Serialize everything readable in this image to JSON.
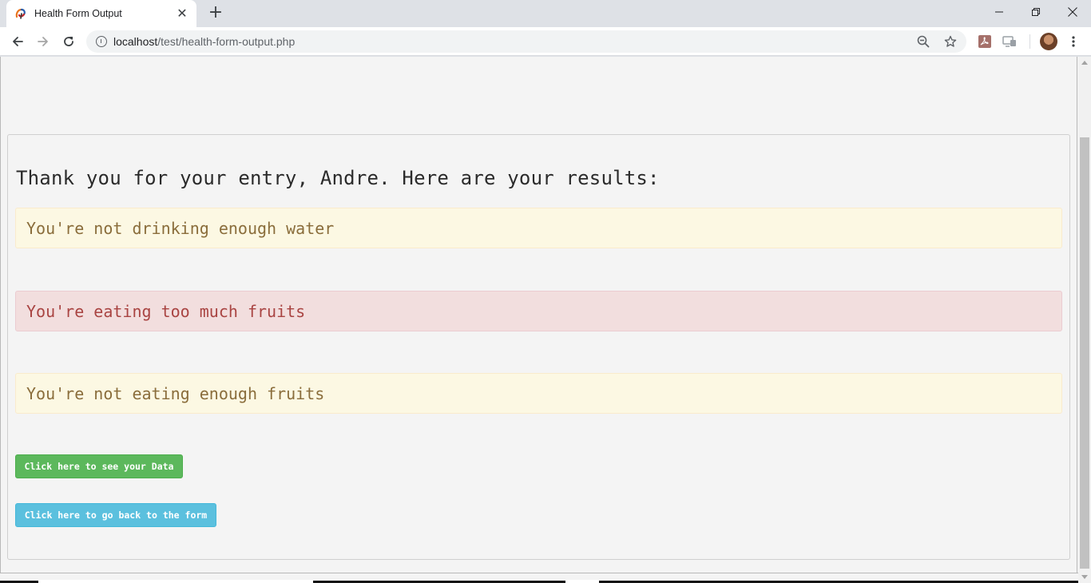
{
  "browser": {
    "tab_title": "Health Form Output",
    "tab_close": "✕",
    "new_tab": "+",
    "url_host": "localhost",
    "url_path": "/test/health-form-output.php"
  },
  "page": {
    "heading": "Thank you for your entry, Andre. Here are your results:",
    "alerts": [
      {
        "type": "warning",
        "text": "You're not drinking enough water"
      },
      {
        "type": "danger",
        "text": "You're eating too much fruits"
      },
      {
        "type": "warning",
        "text": "You're not eating enough fruits"
      }
    ],
    "buttons": {
      "see_data": "Click here to see your Data",
      "back_to_form": "Click here to go back to the form"
    }
  },
  "colors": {
    "warning_bg": "#fcf8e3",
    "warning_text": "#8a6d3b",
    "danger_bg": "#f2dede",
    "danger_text": "#a94442",
    "success_btn": "#5cb85c",
    "info_btn": "#5bc0de"
  },
  "icons": {
    "favicon": "swirl-favicon-icon",
    "back": "arrow-left-icon",
    "forward": "arrow-right-icon",
    "reload": "reload-icon",
    "site_info": "info-icon",
    "zoom": "zoom-out-icon",
    "bookmark": "star-icon",
    "pdf_extension": "pdf-extension-icon",
    "cast": "cast-icon",
    "menu": "kebab-menu-icon"
  }
}
